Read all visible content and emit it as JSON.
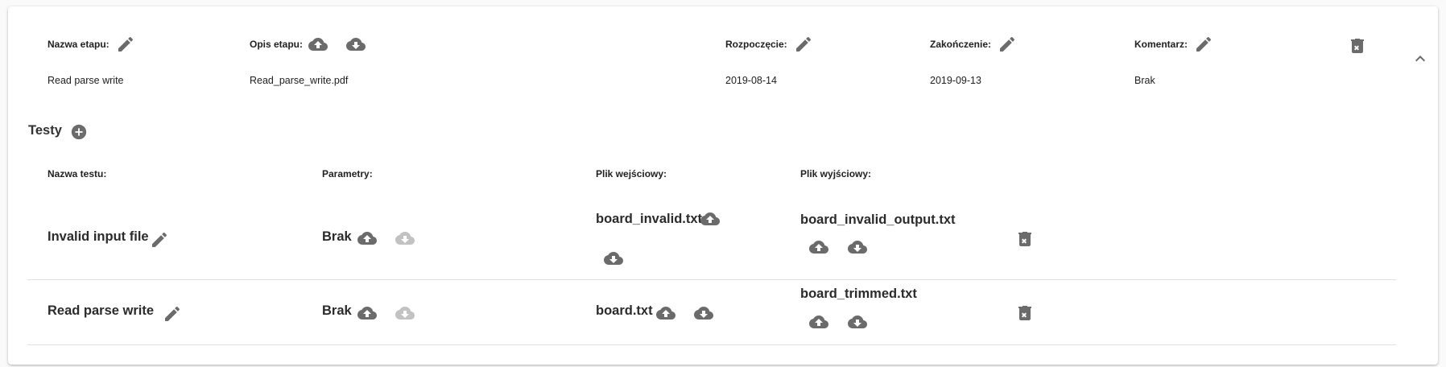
{
  "stage": {
    "headers": {
      "name": "Nazwa etapu:",
      "description": "Opis etapu:",
      "start": "Rozpoczęcie:",
      "end": "Zakończenie:",
      "comment": "Komentarz:"
    },
    "values": {
      "name": "Read parse write",
      "description": "Read_parse_write.pdf",
      "start": "2019-08-14",
      "end": "2019-09-13",
      "comment": "Brak"
    }
  },
  "tests": {
    "title": "Testy",
    "headers": {
      "name": "Nazwa testu:",
      "params": "Parametry:",
      "input": "Plik wejściowy:",
      "output": "Plik wyjściowy:"
    },
    "rows": [
      {
        "name": "Invalid input file",
        "params": "Brak",
        "input_file": "board_invalid.txt",
        "output_file": "board_invalid_output.txt"
      },
      {
        "name": "Read parse write",
        "params": "Brak",
        "input_file": "board.txt",
        "output_file": "board_trimmed.txt"
      }
    ]
  },
  "icons": {
    "edit": "pencil-icon",
    "upload": "cloud-upload-icon",
    "download": "cloud-download-icon",
    "delete": "trash-icon",
    "add": "add-circle-icon",
    "collapse": "chevron-up-icon"
  },
  "colors": {
    "icon": "#6b6b6b",
    "icon_disabled": "#c2c2c2",
    "divider": "#e2e2e2"
  }
}
